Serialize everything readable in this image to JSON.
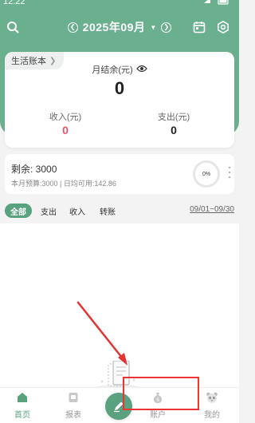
{
  "status_bar": {
    "time": "12:22"
  },
  "header": {
    "month_label": "2025年09月",
    "search_icon": "search-icon",
    "calendar_icon": "calendar-icon",
    "settings_icon": "gear-icon"
  },
  "summary": {
    "book_name": "生活账本",
    "balance_label": "月结余(元)",
    "balance_value": "0",
    "income_label": "收入(元)",
    "income_value": "0",
    "expense_label": "支出(元)",
    "expense_value": "0"
  },
  "budget": {
    "remain_text": "剩余: 3000",
    "detail_text": "本月预算:3000 | 日均可用:142.86",
    "progress": "0%"
  },
  "filters": {
    "tabs": [
      "全部",
      "支出",
      "收入",
      "转账"
    ],
    "active": "全部",
    "date_range": "09/01~09/30"
  },
  "nav": {
    "items": [
      {
        "label": "首页",
        "icon": "home-icon"
      },
      {
        "label": "报表",
        "icon": "report-icon"
      },
      {
        "label": "账户",
        "icon": "money-bag-icon"
      },
      {
        "label": "我的",
        "icon": "panda-icon"
      }
    ],
    "active": "首页",
    "fab_icon": "pen-icon"
  },
  "colors": {
    "primary": "#6bb08e",
    "accent": "#5aa17f",
    "income": "#e8556b",
    "annotation": "#e33333"
  }
}
